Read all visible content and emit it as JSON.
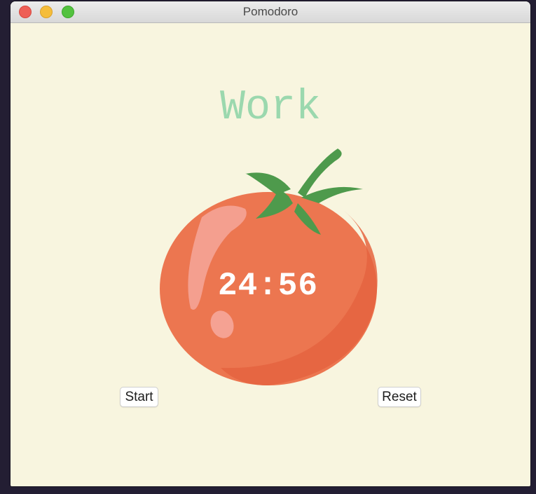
{
  "window": {
    "title": "Pomodoro"
  },
  "main": {
    "heading": "Work",
    "timer": "24:56",
    "start_label": "Start",
    "reset_label": "Reset"
  },
  "icons": {
    "tomato": "tomato-icon",
    "close": "close-icon",
    "minimize": "minimize-icon",
    "maximize": "maximize-icon"
  },
  "colors": {
    "background": "#f8f5df",
    "heading": "#9bd8ae",
    "tomato": "#ec7650",
    "leaves": "#4e9a4c",
    "timer_text": "#ffffff"
  }
}
